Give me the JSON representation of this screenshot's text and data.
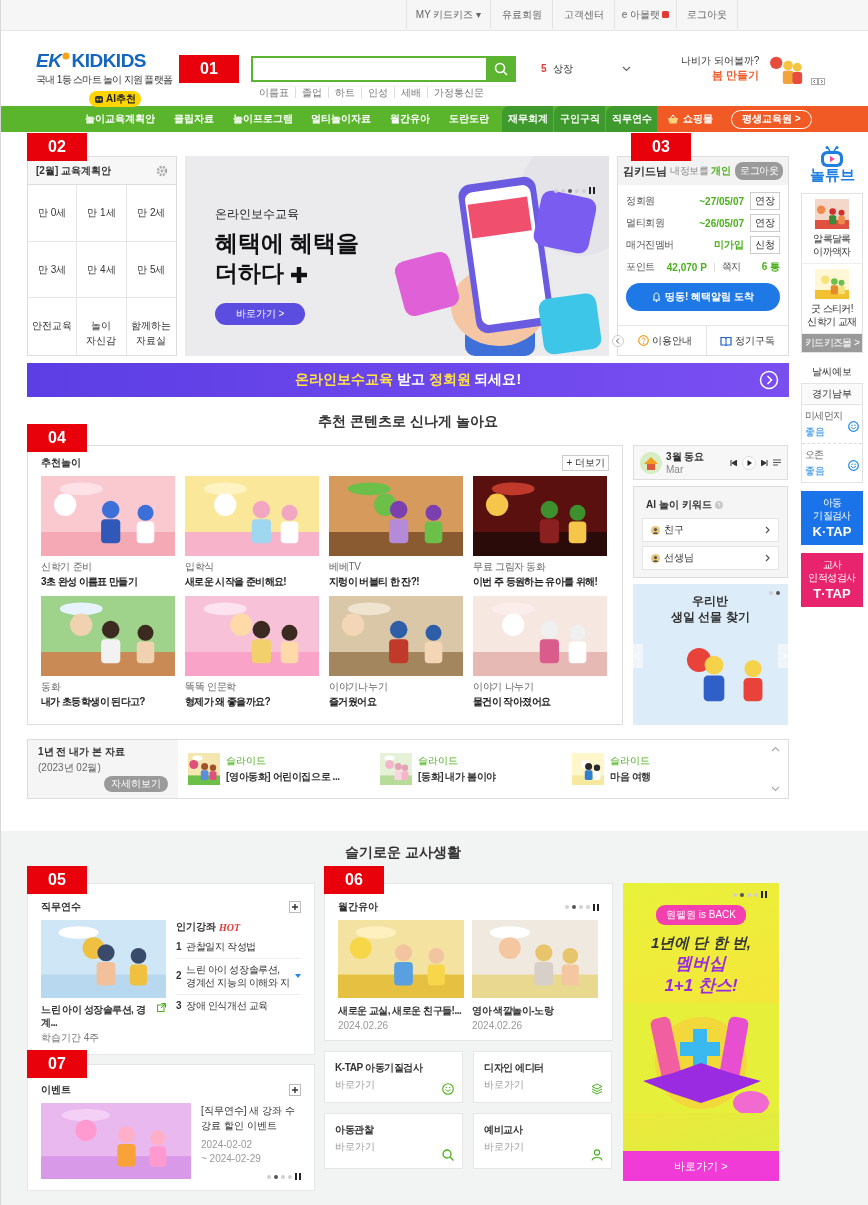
{
  "top_links": [
    {
      "label": "MY 키드키즈 ▾",
      "new": false
    },
    {
      "label": "유료회원",
      "new": false
    },
    {
      "label": "고객센터",
      "new": false
    },
    {
      "label": "e 아몰랫",
      "new": true
    },
    {
      "label": "로그아웃",
      "new": false
    }
  ],
  "header": {
    "logo": {
      "mark": "EK",
      "name": "KIDKIDS",
      "tagline": "국내 1등 스마트 놀이 지원 플랫폼"
    },
    "search": {
      "suggestions": [
        "이름표",
        "졸업",
        "하트",
        "인성",
        "세배",
        "가정통신문"
      ]
    },
    "ranking": {
      "rank": "5",
      "keyword": "상장"
    },
    "promo": {
      "line1": "나비가 되어볼까?",
      "line2": "봄 만들기"
    }
  },
  "nav": {
    "ai_badge": "AI추천",
    "items": [
      "놀이교육계획안",
      "클립자료",
      "놀이프로그램",
      "멀티놀이자료",
      "월간유아",
      "도란도란"
    ],
    "tabs": [
      "재무회계",
      "구인구직",
      "직무연수"
    ],
    "shop": "쇼핑몰",
    "lifelong": "평생교육원 >"
  },
  "section_markers": [
    "01",
    "02",
    "03",
    "04",
    "05",
    "06",
    "07"
  ],
  "edu_plan": {
    "title": "[2월] 교육계획안",
    "cells": [
      "만 0세",
      "만 1세",
      "만 2세",
      "만 3세",
      "만 4세",
      "만 5세",
      "안전교육",
      "놀이 자신감",
      "함께하는 자료실"
    ]
  },
  "main_banner": {
    "eyebrow": "온라인보수교육",
    "headline": [
      "혜택에 혜택을",
      "더하다"
    ],
    "button": "바로가기 >",
    "dots": [
      {
        "selected": false
      },
      {
        "selected": false
      },
      {
        "selected": true
      },
      {
        "selected": false
      },
      {
        "selected": false
      }
    ]
  },
  "user_panel": {
    "name": "김키드님",
    "info": "내정보를",
    "type": "개인",
    "logout": "로그아웃",
    "rows": [
      {
        "label": "정회원",
        "value": "~27/05/07",
        "action": "연장"
      },
      {
        "label": "멀티회원",
        "value": "~26/05/07",
        "action": "연장"
      },
      {
        "label": "매거진멤버",
        "value": "미가입",
        "action": "신청"
      }
    ],
    "points": {
      "label": "포인트",
      "value": "42,070 P"
    },
    "messages": {
      "label": "쪽지",
      "value": "6 통"
    },
    "alert_button": "띵동! 혜택알림 도착",
    "links": [
      "이용안내",
      "정기구독"
    ]
  },
  "promo_strip": {
    "text": "**온라인보수교육** 받고 **정회원** 되세요!"
  },
  "recommend": {
    "heading": "추천 콘텐츠로 신나게 놀아요",
    "title": "추천놀이",
    "more": "+ 더보기",
    "cards": [
      {
        "category": "신학기 준비",
        "title": "3초 완성 이름표 만들기"
      },
      {
        "category": "입학식",
        "title": "새로운 시작을 준비해요!"
      },
      {
        "category": "베베TV",
        "title": "지렁이 버블티 한 잔?!"
      },
      {
        "category": "무료 그림자 동화",
        "title": "이번 주 등원하는 유아를 위해!"
      },
      {
        "category": "동화",
        "title": "내가 초등학생이 된다고?"
      },
      {
        "category": "똑똑 인문학",
        "title": "형제가 왜 좋을까요?"
      },
      {
        "category": "이야기나누기",
        "title": "즐거웠어요"
      },
      {
        "category": "이야기 나누기",
        "title": "물건이 작아졌어요"
      }
    ]
  },
  "player": {
    "title": "3월 동요",
    "subtitle": "Mar"
  },
  "ai_keywords": {
    "title": "AI 놀이 키워드",
    "items": [
      "친구",
      "선생님"
    ]
  },
  "side_banner": {
    "lines": [
      "우리반",
      "생일 선물 찾기"
    ],
    "dots": [
      {
        "selected": false
      },
      {
        "selected": true
      }
    ]
  },
  "recent": {
    "title": "1년 전 내가 본 자료",
    "date": "(2023년 02월)",
    "button": "자세히보기",
    "items": [
      {
        "type": "슬라이드",
        "title": "[영아동화] 어린이집으로 ..."
      },
      {
        "type": "슬라이드",
        "title": "[동화] 내가 봄이야"
      },
      {
        "type": "슬라이드",
        "title": "마음 여행"
      }
    ]
  },
  "sidebar": {
    "logo": "놀튜브",
    "products": [
      "알록달록 이까액자",
      "굿 스티커! 신학기 교재"
    ],
    "mall": "키드키즈몰 >",
    "weather": {
      "title": "날씨예보",
      "region": "경기남부",
      "rows": [
        {
          "label": "미세먼지",
          "value": "좋음"
        },
        {
          "label": "오존",
          "value": "좋음"
        }
      ]
    },
    "tests": [
      {
        "sub": "아동 기질검사",
        "name": "K·TAP"
      },
      {
        "sub": "교사 인적성검사",
        "name": "T·TAP"
      }
    ]
  },
  "teacher": {
    "heading": "슬기로운 교사생활",
    "training": {
      "title": "직무연수",
      "course": "느린 아이 성장솔루션, 경계...",
      "period": "학습기간 4주",
      "popular": "인기강좌",
      "hot": "HOT",
      "lectures": [
        {
          "num": "1",
          "title": "관찰일지 작성법"
        },
        {
          "num": "2",
          "title": "느린 아이 성장솔루션, 경계선 지능의 이해와 지"
        },
        {
          "num": "3",
          "title": "장애 인식개선 교육"
        }
      ]
    },
    "monthly": {
      "title": "월간유아",
      "dots": [
        {
          "selected": false
        },
        {
          "selected": true
        },
        {
          "selected": false
        },
        {
          "selected": false
        }
      ],
      "items": [
        {
          "title": "새로운 교실, 새로운 친구들!...",
          "date": "2024.02.26"
        },
        {
          "title": "영아 색깔놀이-노랑",
          "date": "2024.02.26"
        }
      ]
    },
    "event": {
      "title": "이벤트",
      "text": "[직무연수] 새 강좌 수강료 할인 이벤트",
      "start": "2024-02-02",
      "end": "~ 2024-02-29",
      "dots": [
        {
          "selected": false
        },
        {
          "selected": true
        },
        {
          "selected": false
        },
        {
          "selected": false
        }
      ]
    },
    "quick_links": [
      {
        "title": "K-TAP 아동기질검사",
        "sub": "바로가기"
      },
      {
        "title": "디자인 에디터",
        "sub": "바로가기"
      },
      {
        "title": "아동관찰",
        "sub": "바로가기"
      },
      {
        "title": "예비교사",
        "sub": "바로가기"
      }
    ],
    "ad": {
      "badge": "원펠원 is BACK",
      "lines": [
        "1년에 단 한 번,",
        "멤버십",
        "1+1 찬스!"
      ],
      "button": "바로가기 >",
      "dots": [
        {
          "selected": false
        },
        {
          "selected": true
        },
        {
          "selected": false
        },
        {
          "selected": false
        }
      ]
    }
  }
}
